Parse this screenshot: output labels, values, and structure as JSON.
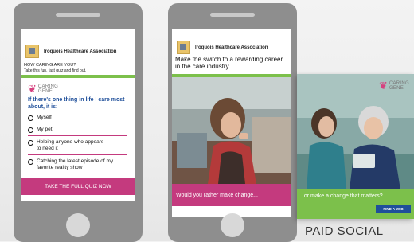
{
  "phone1": {
    "org_name": "Iroquois Healthcare Association",
    "headline": "HOW CARING ARE YOU?",
    "subline": "Take this fun, fast quiz and find out.",
    "brand": {
      "line1": "CARING",
      "line2": "GENE"
    },
    "question": "If there's one thing in life I care most about, it is:",
    "options": [
      "Myself",
      "My pet",
      "Helping anyone who appears to need it",
      "Catching the latest episode of my favorite reality show"
    ],
    "cta": "TAKE THE FULL QUIZ NOW"
  },
  "phone2": {
    "org_name": "Iroquois Healthcare Association",
    "headline": "Make the switch to a rewarding career in the care industry.",
    "banner": "Would you rather make change..."
  },
  "card": {
    "brand": {
      "line1": "CARING",
      "line2": "GENE"
    },
    "banner": "...or make a change that matters?",
    "button": "FIND A JOB"
  },
  "section_label": "PAID SOCIAL",
  "colors": {
    "green": "#7cc04b",
    "pink": "#c43a7e",
    "blue": "#1f4f9a"
  }
}
